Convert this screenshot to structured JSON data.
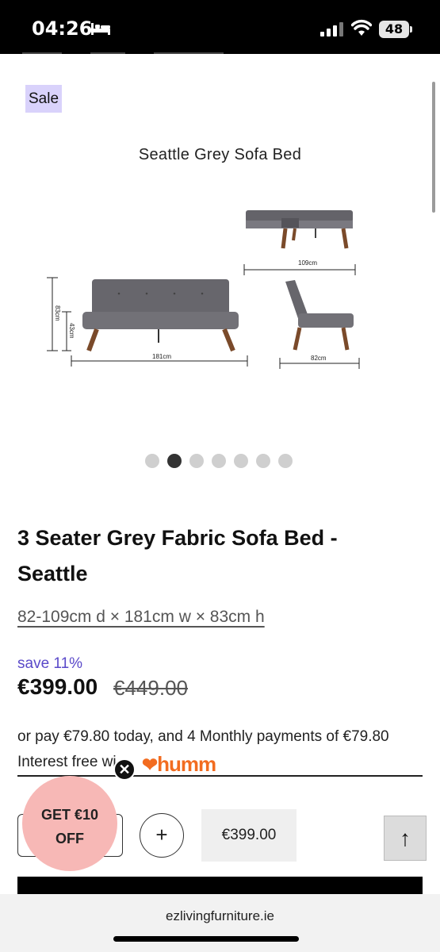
{
  "status_bar": {
    "time": "04:26",
    "battery": "48"
  },
  "badge": {
    "label": "Sale"
  },
  "gallery": {
    "title": "Seattle Grey Sofa Bed",
    "dimension_labels": {
      "depth_extended": "109cm",
      "height": "83cm",
      "seat_height": "43cm",
      "width": "181cm",
      "depth": "82cm"
    },
    "dots_total": 7,
    "active_dot": 2
  },
  "product": {
    "title_line1": "3 Seater Grey Fabric Sofa Bed -",
    "title_line2": "Seattle",
    "dimensions": "82-109cm d × 181cm w × 83cm h",
    "save": "save 11%",
    "price": "€399.00",
    "was_price": "€449.00",
    "pay_line": "or pay €79.80 today, and 4 Monthly payments of €79.80",
    "interest": "Interest free wi",
    "humm": "humm"
  },
  "actions": {
    "plus": "+",
    "price_button": "€399.00",
    "back_to_top": "↑"
  },
  "promo": {
    "line1": "GET €10",
    "line2": "OFF",
    "close": "✕"
  },
  "browser": {
    "url": "ezlivingfurniture.ie"
  },
  "colors": {
    "sale_badge": "#d9d2fb",
    "save_text": "#5a49c9",
    "humm_orange": "#f26c20",
    "promo_pink": "#f7b8b6"
  }
}
